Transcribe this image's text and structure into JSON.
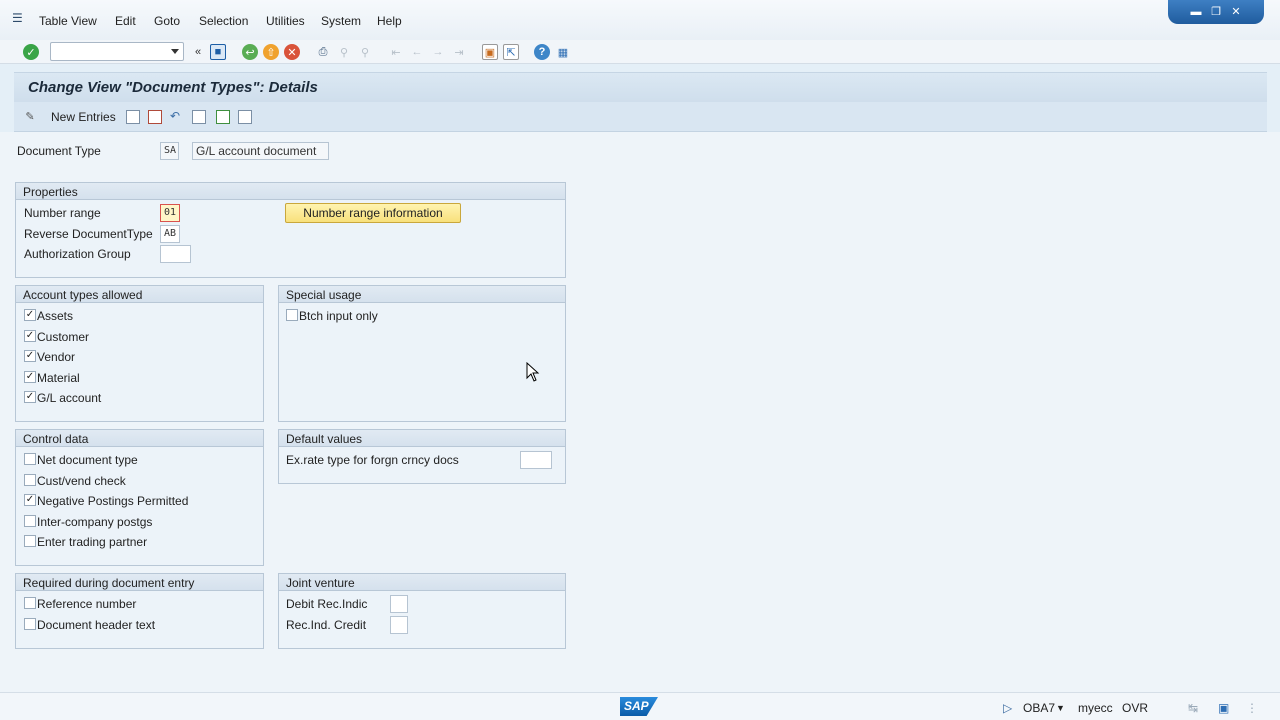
{
  "menu": {
    "items": [
      "Table View",
      "Edit",
      "Goto",
      "Selection",
      "Utilities",
      "System",
      "Help"
    ]
  },
  "window_controls": [
    "minimize-icon",
    "restore-icon",
    "close-icon"
  ],
  "toolbar": {
    "command_field_value": "",
    "icons": [
      "enter-icon",
      "back-nav-icon",
      "save-icon",
      "back-icon",
      "exit-icon",
      "cancel-icon",
      "print-icon",
      "find-icon",
      "find-next-icon",
      "first-page-icon",
      "previous-page-icon",
      "next-page-icon",
      "last-page-icon",
      "new-session-icon",
      "shortcut-icon",
      "help-icon",
      "layout-icon"
    ]
  },
  "screen": {
    "title": "Change View \"Document Types\": Details"
  },
  "app_toolbar": {
    "new_entries_label": "New Entries"
  },
  "document_type": {
    "label": "Document Type",
    "code": "SA",
    "description": "G/L account document"
  },
  "properties": {
    "title": "Properties",
    "number_range_label": "Number range",
    "number_range_value": "01",
    "number_range_info_button": "Number range information",
    "reverse_doc_type_label": "Reverse DocumentType",
    "reverse_doc_type_value": "AB",
    "auth_group_label": "Authorization Group",
    "auth_group_value": ""
  },
  "account_types": {
    "title": "Account types allowed",
    "items": [
      {
        "label": "Assets",
        "checked": true
      },
      {
        "label": "Customer",
        "checked": true
      },
      {
        "label": "Vendor",
        "checked": true
      },
      {
        "label": "Material",
        "checked": true
      },
      {
        "label": "G/L account",
        "checked": true
      }
    ]
  },
  "special_usage": {
    "title": "Special usage",
    "items": [
      {
        "label": "Btch input only",
        "checked": false
      }
    ]
  },
  "control_data": {
    "title": "Control data",
    "items": [
      {
        "label": "Net document type",
        "checked": false
      },
      {
        "label": "Cust/vend check",
        "checked": false
      },
      {
        "label": "Negative Postings Permitted",
        "checked": true
      },
      {
        "label": "Inter-company postgs",
        "checked": false
      },
      {
        "label": "Enter trading partner",
        "checked": false
      }
    ]
  },
  "default_values": {
    "title": "Default values",
    "exrate_label": "Ex.rate type for forgn crncy docs",
    "exrate_value": ""
  },
  "required_entry": {
    "title": "Required during document entry",
    "items": [
      {
        "label": "Reference number",
        "checked": false
      },
      {
        "label": "Document header text",
        "checked": false
      }
    ]
  },
  "joint_venture": {
    "title": "Joint venture",
    "debit_label": "Debit Rec.Indic",
    "debit_value": "",
    "credit_label": "Rec.Ind. Credit",
    "credit_value": ""
  },
  "status_bar": {
    "logo": "SAP",
    "transaction": "OBA7",
    "system": "myecc",
    "mode": "OVR"
  }
}
